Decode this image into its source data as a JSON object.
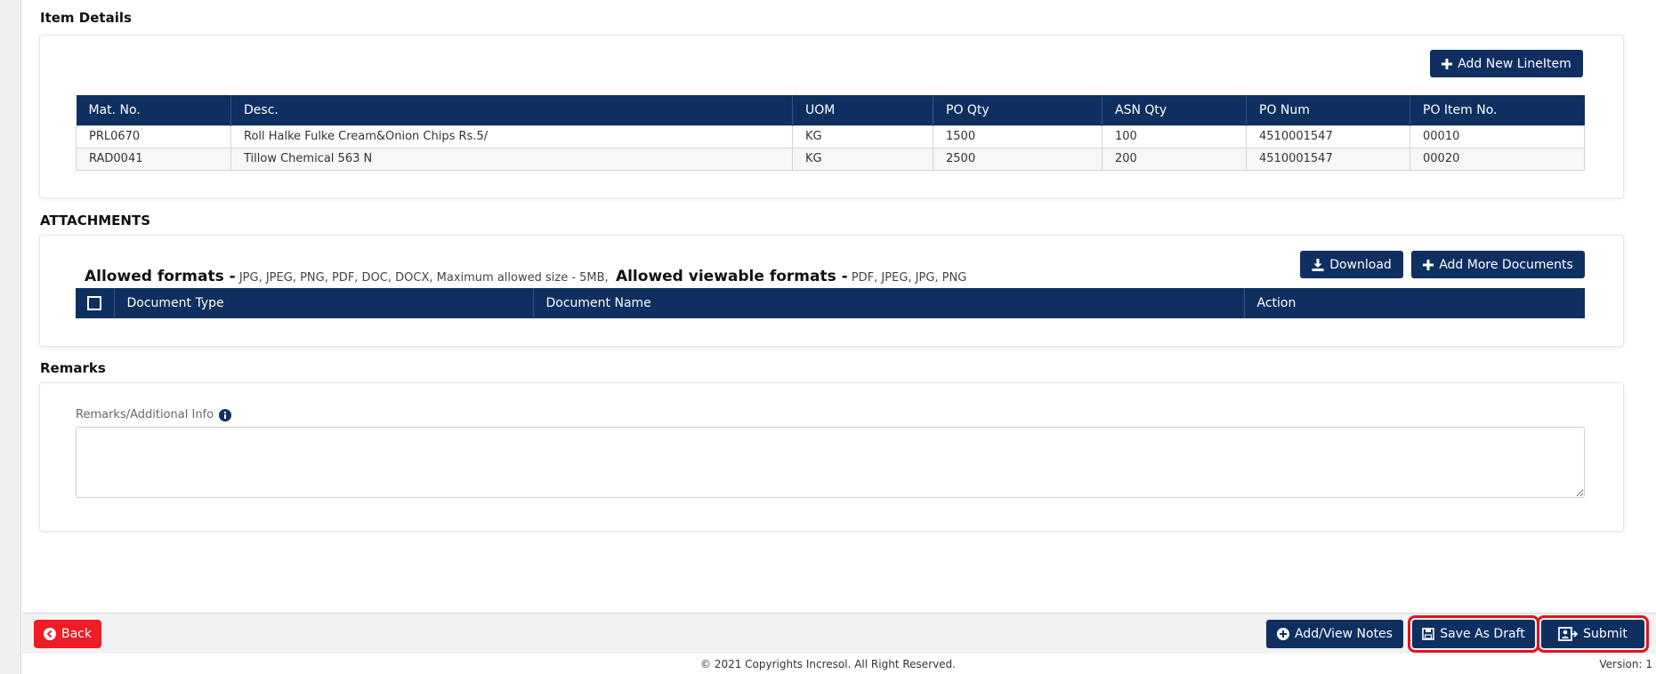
{
  "item_details": {
    "title": "Item Details",
    "add_button": "Add New LineItem",
    "columns": [
      "Mat. No.",
      "Desc.",
      "UOM",
      "PO Qty",
      "ASN Qty",
      "PO Num",
      "PO Item No."
    ],
    "rows": [
      [
        "PRL0670",
        "Roll Halke Fulke Cream&Onion Chips Rs.5/",
        "KG",
        "1500",
        "100",
        "4510001547",
        "00010"
      ],
      [
        "RAD0041",
        "Tillow Chemical 563 N",
        "KG",
        "2500",
        "200",
        "4510001547",
        "00020"
      ]
    ]
  },
  "attachments": {
    "title": "ATTACHMENTS",
    "allowed_label": "Allowed formats -",
    "allowed_values": "JPG, JPEG, PNG, PDF, DOC, DOCX, Maximum allowed size - 5MB,",
    "viewable_label": "Allowed viewable formats -",
    "viewable_values": "PDF, JPEG, JPG, PNG",
    "download_button": "Download",
    "add_more_button": "Add More Documents",
    "columns": [
      "Document Type",
      "Document Name",
      "Action"
    ]
  },
  "remarks": {
    "title": "Remarks",
    "label": "Remarks/Additional Info",
    "value": ""
  },
  "footer": {
    "back_button": "Back",
    "notes_button": "Add/View Notes",
    "draft_button": "Save As Draft",
    "submit_button": "Submit",
    "copyright": "© 2021 Copyrights Incresol. All Right Reserved.",
    "version": "Version: 1"
  },
  "colors": {
    "primary": "#0f2f60",
    "danger": "#ee1c25",
    "highlight": "#e0141e"
  }
}
